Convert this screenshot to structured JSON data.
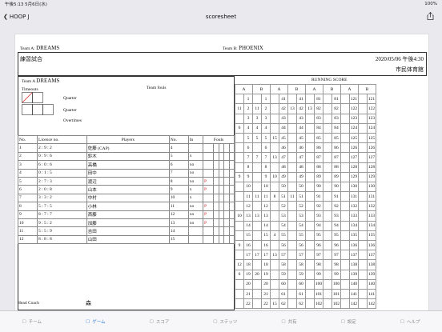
{
  "status": {
    "time": "午後5:13",
    "date": "5月6日(水)",
    "battery": "100%"
  },
  "nav": {
    "back_label": "HOOP J",
    "title": "scoresheet"
  },
  "sheet": {
    "team_a_label": "Team A:",
    "team_a_name": "DREAMS",
    "team_b_label": "Team B:",
    "team_b_name": "PHOENIX",
    "game_name": "練習試合",
    "datetime": "2020/05/06 午後4:30",
    "venue": "市民体育館",
    "section_team_a": "Team A",
    "section_team_a_name": "DREAMS",
    "timeouts": "Timeouts",
    "team_fouls": "Team fouls",
    "quarter": "Quarter",
    "overtimes": "Overtimes",
    "running_score": "RUNNING SCORE",
    "head_coach": "Head Coach",
    "head_coach_name": "森",
    "cols": {
      "no": "No.",
      "licence": "Licence no.",
      "players": "Players",
      "no2": "No.",
      "in": "In",
      "fouls": "Fouls"
    },
    "players": [
      {
        "r": "1",
        "lic": "2 : 9 : 2",
        "name": "佐藤 (CAP)",
        "no": "4",
        "in": "",
        "p": ""
      },
      {
        "r": "2",
        "lic": "0 : 9 : 6",
        "name": "鈴木",
        "no": "5",
        "in": "x",
        "p": ""
      },
      {
        "r": "3",
        "lic": "6 : 0 : 6",
        "name": "高橋",
        "no": "6",
        "in": "xo",
        "p": ""
      },
      {
        "r": "4",
        "lic": "0 : 1 : 5",
        "name": "田中",
        "no": "7",
        "in": "xo",
        "p": ""
      },
      {
        "r": "5",
        "lic": "2 : 7 : 3",
        "name": "渡辺",
        "no": "8",
        "in": "xo",
        "p": "P"
      },
      {
        "r": "6",
        "lic": "2 : 0 : 8",
        "name": "山本",
        "no": "9",
        "in": "x",
        "p": "P"
      },
      {
        "r": "7",
        "lic": "3 : 3 : 2",
        "name": "中村",
        "no": "10",
        "in": "x",
        "p": ""
      },
      {
        "r": "8",
        "lic": "5 : 7 : 5",
        "name": "小林",
        "no": "11",
        "in": "xo",
        "p": "P"
      },
      {
        "r": "9",
        "lic": "8 : 7 : 7",
        "name": "斎藤",
        "no": "12",
        "in": "xo",
        "p": "P"
      },
      {
        "r": "10",
        "lic": "9 : 5 : 2",
        "name": "加藤",
        "no": "13",
        "in": "xo",
        "p": "P"
      },
      {
        "r": "11",
        "lic": "5 : 5 : 9",
        "name": "吉田",
        "no": "14",
        "in": "",
        "p": ""
      },
      {
        "r": "12",
        "lic": "8 : 8 : 8",
        "name": "山田",
        "no": "15",
        "in": "",
        "p": ""
      }
    ],
    "rs_rows": [
      [
        "",
        "1",
        "",
        "1",
        "",
        "41",
        "",
        "41",
        "",
        "81",
        "",
        "81",
        "",
        "121",
        "",
        "121"
      ],
      [
        "11",
        "2",
        "11",
        "2",
        "",
        "42",
        "13",
        "42",
        "13",
        "82",
        "",
        "82",
        "",
        "122",
        "",
        "122"
      ],
      [
        "",
        "3",
        "3",
        "3",
        "",
        "43",
        "",
        "43",
        "",
        "83",
        "",
        "83",
        "",
        "123",
        "",
        "123"
      ],
      [
        "6",
        "4",
        "4",
        "4",
        "",
        "44",
        "",
        "44",
        "",
        "84",
        "",
        "84",
        "",
        "124",
        "",
        "124"
      ],
      [
        "",
        "5",
        "5",
        "5",
        "15",
        "45",
        "",
        "45",
        "",
        "85",
        "",
        "85",
        "",
        "125",
        "",
        "125"
      ],
      [
        "",
        "6",
        "",
        "6",
        "",
        "46",
        "",
        "46",
        "",
        "86",
        "",
        "86",
        "",
        "126",
        "",
        "126"
      ],
      [
        "",
        "7",
        "7",
        "7",
        "13",
        "47",
        "",
        "47",
        "",
        "87",
        "",
        "87",
        "",
        "127",
        "",
        "127"
      ],
      [
        "",
        "8",
        "",
        "8",
        "",
        "48",
        "",
        "48",
        "",
        "88",
        "",
        "88",
        "",
        "128",
        "",
        "128"
      ],
      [
        "9",
        "9",
        "",
        "9",
        "10",
        "49",
        "",
        "49",
        "",
        "89",
        "",
        "89",
        "",
        "129",
        "",
        "129"
      ],
      [
        "",
        "10",
        "",
        "10",
        "",
        "50",
        "",
        "50",
        "",
        "90",
        "",
        "90",
        "",
        "130",
        "",
        "130"
      ],
      [
        "",
        "11",
        "11",
        "11",
        "8",
        "51",
        "11",
        "51",
        "",
        "91",
        "",
        "91",
        "",
        "131",
        "",
        "131"
      ],
      [
        "",
        "12",
        "",
        "12",
        "",
        "52",
        "",
        "52",
        "",
        "92",
        "",
        "92",
        "",
        "132",
        "",
        "132"
      ],
      [
        "10",
        "13",
        "13",
        "13",
        "",
        "53",
        "",
        "53",
        "",
        "93",
        "",
        "93",
        "",
        "133",
        "",
        "133"
      ],
      [
        "",
        "14",
        "",
        "14",
        "",
        "54",
        "",
        "54",
        "",
        "94",
        "",
        "94",
        "",
        "134",
        "",
        "134"
      ],
      [
        "",
        "15",
        "",
        "15",
        "4",
        "55",
        "",
        "55",
        "",
        "95",
        "",
        "95",
        "",
        "135",
        "",
        "135"
      ],
      [
        "9",
        "16",
        "",
        "16",
        "",
        "56",
        "",
        "56",
        "",
        "96",
        "",
        "96",
        "",
        "136",
        "",
        "136"
      ],
      [
        "",
        "17",
        "17",
        "17",
        "13",
        "57",
        "",
        "57",
        "",
        "97",
        "",
        "97",
        "",
        "137",
        "",
        "137"
      ],
      [
        "12",
        "18",
        "",
        "18",
        "",
        "58",
        "",
        "58",
        "",
        "98",
        "",
        "98",
        "",
        "138",
        "",
        "138"
      ],
      [
        "6",
        "19",
        "20",
        "19",
        "",
        "59",
        "",
        "59",
        "",
        "99",
        "",
        "99",
        "",
        "139",
        "",
        "139"
      ],
      [
        "",
        "20",
        "",
        "20",
        "",
        "60",
        "",
        "60",
        "",
        "100",
        "",
        "100",
        "",
        "140",
        "",
        "140"
      ],
      [
        "",
        "21",
        "",
        "21",
        "",
        "61",
        "",
        "61",
        "",
        "101",
        "",
        "101",
        "",
        "141",
        "",
        "141"
      ],
      [
        "",
        "22",
        "",
        "22",
        "15",
        "62",
        "",
        "62",
        "",
        "102",
        "",
        "102",
        "",
        "142",
        "",
        "142"
      ]
    ]
  },
  "tabs": [
    {
      "icon": "team-icon",
      "label": "チーム"
    },
    {
      "icon": "game-icon",
      "label": "ゲーム"
    },
    {
      "icon": "score-icon",
      "label": "スコア"
    },
    {
      "icon": "stats-icon",
      "label": "ステッツ"
    },
    {
      "icon": "share-icon",
      "label": "共有"
    },
    {
      "icon": "settings-icon",
      "label": "設定"
    },
    {
      "icon": "help-icon",
      "label": "ヘルプ"
    }
  ],
  "accent_color": "#2e7bd6"
}
